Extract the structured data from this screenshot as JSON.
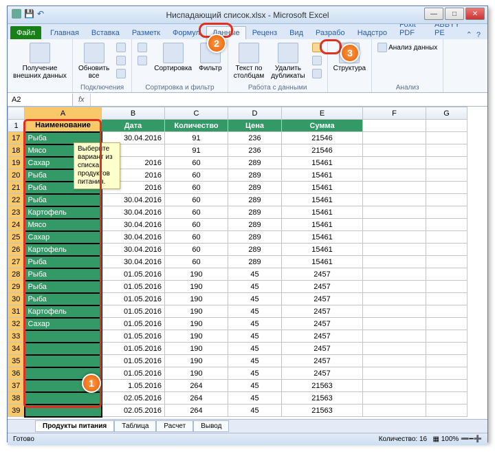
{
  "title": "Ниспадающий список.xlsx - Microsoft Excel",
  "tabs": {
    "file": "Файл",
    "home": "Главная",
    "insert": "Вставка",
    "layout": "Разметк",
    "formulas": "Формул",
    "data": "Данные",
    "review": "Реценз",
    "view": "Вид",
    "dev": "Разрабо",
    "add": "Надстро",
    "foxit": "Foxit PDF",
    "abbyy": "ABBYY PE"
  },
  "ribbon": {
    "get_data": "Получение\nвнешних данных",
    "refresh": "Обновить\nвсе",
    "connections": "Подключения",
    "sort": "Сортировка",
    "filter": "Фильтр",
    "sort_filter": "Сортировка и фильтр",
    "text_cols": "Текст по\nстолбцам",
    "dedupe": "Удалить\nдубликаты",
    "validation": "Проверка данных",
    "data_tools": "Работа с данными",
    "outline": "Структура",
    "analysis": "Анализ данных",
    "analysis_grp": "Анализ"
  },
  "namebox": "A2",
  "cols": [
    "",
    "A",
    "B",
    "C",
    "D",
    "E",
    "F",
    "G"
  ],
  "headers": {
    "a": "Наименование",
    "b": "Дата",
    "c": "Количество",
    "d": "Цена",
    "e": "Сумма"
  },
  "tooltip": "Выберите вариант из списка продуктов питания.",
  "rows": [
    {
      "n": 17,
      "a": "Рыба",
      "b": "30.04.2016",
      "c": 91,
      "d": 236,
      "e": 21546
    },
    {
      "n": 18,
      "a": "Мясо",
      "b": "",
      "c": 91,
      "d": 236,
      "e": 21546
    },
    {
      "n": 19,
      "a": "Сахар",
      "b": "2016",
      "c": 60,
      "d": 289,
      "e": 15461
    },
    {
      "n": 20,
      "a": "Рыба",
      "b": "2016",
      "c": 60,
      "d": 289,
      "e": 15461
    },
    {
      "n": 21,
      "a": "Рыба",
      "b": "2016",
      "c": 60,
      "d": 289,
      "e": 15461
    },
    {
      "n": 22,
      "a": "Рыба",
      "b": "30.04.2016",
      "c": 60,
      "d": 289,
      "e": 15461
    },
    {
      "n": 23,
      "a": "Картофель",
      "b": "30.04.2016",
      "c": 60,
      "d": 289,
      "e": 15461
    },
    {
      "n": 24,
      "a": "Мясо",
      "b": "30.04.2016",
      "c": 60,
      "d": 289,
      "e": 15461
    },
    {
      "n": 25,
      "a": "Сахар",
      "b": "30.04.2016",
      "c": 60,
      "d": 289,
      "e": 15461
    },
    {
      "n": 26,
      "a": "Картофель",
      "b": "30.04.2016",
      "c": 60,
      "d": 289,
      "e": 15461
    },
    {
      "n": 27,
      "a": "Рыба",
      "b": "30.04.2016",
      "c": 60,
      "d": 289,
      "e": 15461
    },
    {
      "n": 28,
      "a": "Рыба",
      "b": "01.05.2016",
      "c": 190,
      "d": 45,
      "e": 2457
    },
    {
      "n": 29,
      "a": "Рыба",
      "b": "01.05.2016",
      "c": 190,
      "d": 45,
      "e": 2457
    },
    {
      "n": 30,
      "a": "Рыба",
      "b": "01.05.2016",
      "c": 190,
      "d": 45,
      "e": 2457
    },
    {
      "n": 31,
      "a": "Картофель",
      "b": "01.05.2016",
      "c": 190,
      "d": 45,
      "e": 2457
    },
    {
      "n": 32,
      "a": "Сахар",
      "b": "01.05.2016",
      "c": 190,
      "d": 45,
      "e": 2457
    },
    {
      "n": 33,
      "a": "",
      "b": "01.05.2016",
      "c": 190,
      "d": 45,
      "e": 2457
    },
    {
      "n": 34,
      "a": "",
      "b": "01.05.2016",
      "c": 190,
      "d": 45,
      "e": 2457
    },
    {
      "n": 35,
      "a": "",
      "b": "01.05.2016",
      "c": 190,
      "d": 45,
      "e": 2457
    },
    {
      "n": 36,
      "a": "",
      "b": "01.05.2016",
      "c": 190,
      "d": 45,
      "e": 2457
    },
    {
      "n": 37,
      "a": "",
      "b": "1.05.2016",
      "c": 264,
      "d": 45,
      "e": 21563
    },
    {
      "n": 38,
      "a": "",
      "b": "02.05.2016",
      "c": 264,
      "d": 45,
      "e": 21563
    },
    {
      "n": 39,
      "a": "",
      "b": "02.05.2016",
      "c": 264,
      "d": 45,
      "e": 21563
    }
  ],
  "sheets": {
    "s1": "Продукты питания",
    "s2": "Таблица",
    "s3": "Расчет",
    "s4": "Вывод"
  },
  "status": {
    "ready": "Готово",
    "count": "Количество: 16",
    "zoom": "100%"
  },
  "callouts": {
    "c1": "1",
    "c2": "2",
    "c3": "3"
  }
}
